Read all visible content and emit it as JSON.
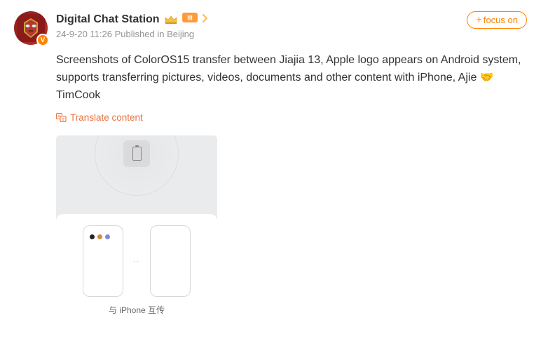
{
  "header": {
    "username": "Digital Chat Station",
    "timestamp": "24-9-20 11:26",
    "published_in": "Published in",
    "location": "Beijing",
    "verify_glyph": "V"
  },
  "focus": {
    "label": "focus on",
    "plus": "+"
  },
  "content": {
    "text_before_emoji": "Screenshots of ColorOS15 transfer between Jiajia 13, Apple logo appears on Android system, supports transferring pictures, videos, documents and other content with iPhone, Ajie ",
    "emoji": "🤝",
    "text_after_emoji": " TimCook"
  },
  "translate": {
    "label": "Translate content"
  },
  "image": {
    "caption": "与 iPhone 互传",
    "dots": "··",
    "apple_glyph": ""
  }
}
